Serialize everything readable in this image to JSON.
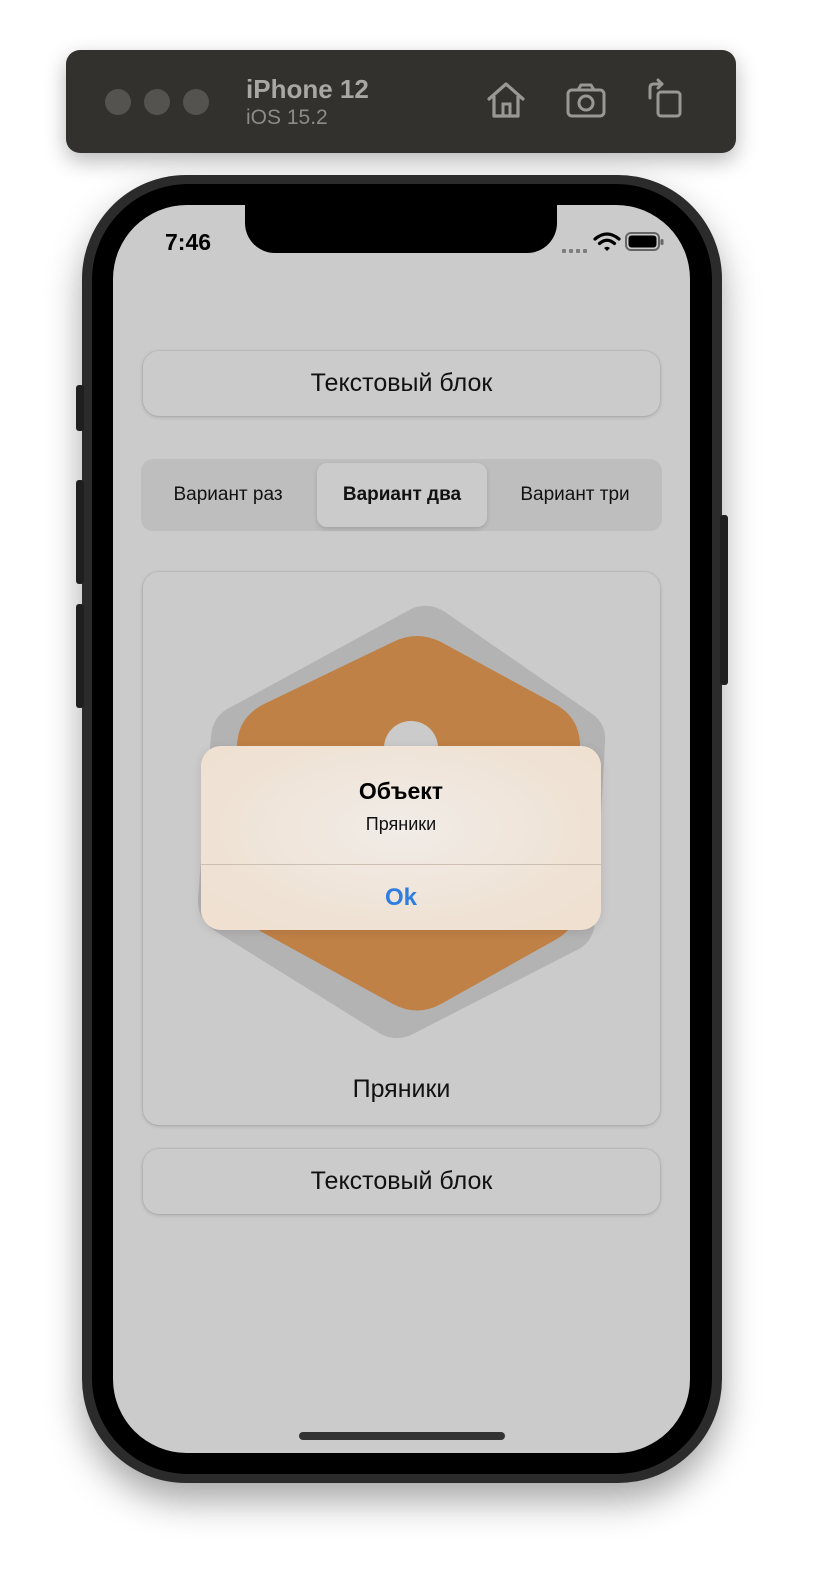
{
  "simulator": {
    "device_name": "iPhone 12",
    "os_version": "iOS 15.2",
    "icons": [
      "home-icon",
      "screenshot-icon",
      "rotate-icon"
    ]
  },
  "status_bar": {
    "time": "7:46",
    "icons": [
      "cellular-icon",
      "wifi-icon",
      "battery-icon"
    ]
  },
  "app": {
    "top_text_block": "Текстовый блок",
    "segmented_control": {
      "options": [
        "Вариант раз",
        "Вариант два",
        "Вариант три"
      ],
      "selected_index": 1
    },
    "item_card": {
      "image": "donut-icon",
      "label": "Пряники",
      "image_color": "#c08146"
    },
    "bottom_text_block": "Текстовый блок"
  },
  "alert": {
    "title": "Объект",
    "message": "Пряники",
    "button_label": "Ok",
    "button_color": "#2f7de0"
  }
}
